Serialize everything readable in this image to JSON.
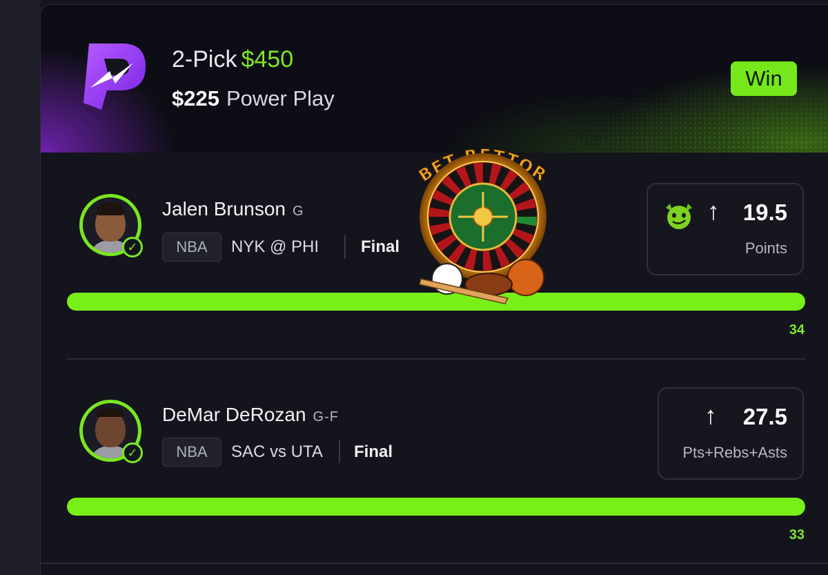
{
  "header": {
    "pick_type": "2-Pick",
    "payout": "$450",
    "entry_amount": "$225",
    "play_type": "Power Play",
    "result_badge": "Win"
  },
  "picks": [
    {
      "player": "Jalen Brunson",
      "position": "G",
      "league": "NBA",
      "matchup": "NYK @ PHI",
      "status": "Final",
      "direction_icon": "arrow-up-icon",
      "modifier_icon": "goblin-icon",
      "line": "19.5",
      "stat": "Points",
      "actual": "34",
      "progress": 1.0
    },
    {
      "player": "DeMar DeRozan",
      "position": "G-F",
      "league": "NBA",
      "matchup": "SAC vs UTA",
      "status": "Final",
      "direction_icon": "arrow-up-icon",
      "line": "27.5",
      "stat": "Pts+Rebs+Asts",
      "actual": "33",
      "progress": 1.0
    }
  ],
  "watermark": {
    "text": "BET BETTOR"
  },
  "colors": {
    "accent_green": "#79e622",
    "brand_purple": "#8a2be2",
    "background": "#13141c"
  }
}
